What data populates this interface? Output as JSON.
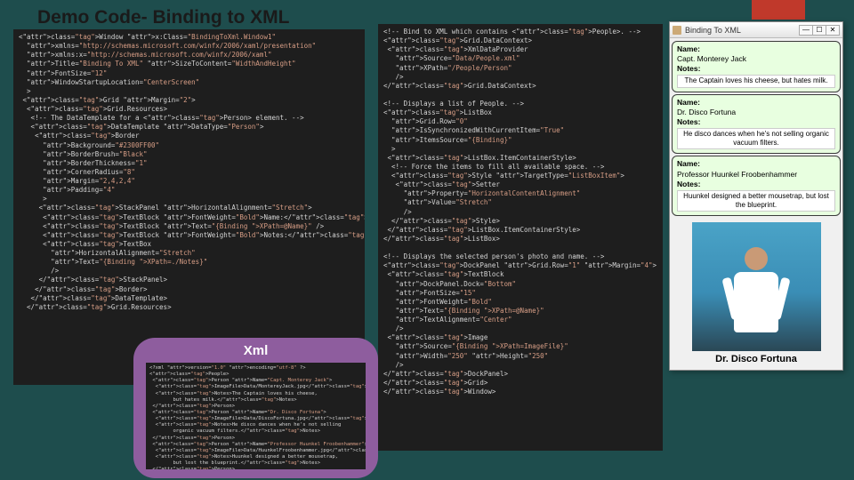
{
  "slide": {
    "title": "Demo Code- Binding to XML"
  },
  "code_left": "<Window x:Class=\"BindingToXml.Window1\"\n  xmlns=\"http://schemas.microsoft.com/winfx/2006/xaml/presentation\"\n  xmlns:x=\"http://schemas.microsoft.com/winfx/2006/xaml\"\n  Title=\"Binding To XML\" SizeToContent=\"WidthAndHeight\"\n  FontSize=\"12\"\n  WindowStartupLocation=\"CenterScreen\"\n  >\n <Grid Margin=\"2\">\n  <Grid.Resources>\n   <!-- The DataTemplate for a <Person> element. -->\n   <DataTemplate DataType=\"Person\">\n    <Border\n      Background=\"#2300FF00\"\n      BorderBrush=\"Black\"\n      BorderThickness=\"1\"\n      CornerRadius=\"8\"\n      Margin=\"2,4,2,4\"\n      Padding=\"4\"\n      >\n     <StackPanel HorizontalAlignment=\"Stretch\">\n      <TextBlock FontWeight=\"Bold\">Name:</TextBlock>\n      <TextBlock Text=\"{Binding XPath=@Name}\" />\n      <TextBlock FontWeight=\"Bold\">Notes:</TextBlock>\n      <TextBox\n        HorizontalAlignment=\"Stretch\"\n        Text=\"{Binding XPath=./Notes}\"\n        />\n     </StackPanel>\n    </Border>\n   </DataTemplate>\n  </Grid.Resources>",
  "code_mid": "<!-- Bind to XML which contains <People>. -->\n<Grid.DataContext>\n <XmlDataProvider\n   Source=\"Data/People.xml\"\n   XPath=\"/People/Person\"\n   />\n</Grid.DataContext>\n\n<!-- Displays a list of People. -->\n<ListBox\n  Grid.Row=\"0\"\n  IsSynchronizedWithCurrentItem=\"True\"\n  ItemsSource=\"{Binding}\"\n  >\n <ListBox.ItemContainerStyle>\n  <!-- Force the items to fill all available space. -->\n  <Style TargetType=\"ListBoxItem\">\n   <Setter\n     Property=\"HorizontalContentAlignment\"\n     Value=\"Stretch\"\n     />\n  </Style>\n </ListBox.ItemContainerStyle>\n</ListBox>\n\n<!-- Displays the selected person's photo and name. -->\n<DockPanel Grid.Row=\"1\" Margin=\"4\">\n <TextBlock\n   DockPanel.Dock=\"Bottom\"\n   FontSize=\"15\"\n   FontWeight=\"Bold\"\n   Text=\"{Binding XPath=@Name}\"\n   TextAlignment=\"Center\"\n   />\n <Image\n   Source=\"{Binding XPath=ImageFile}\"\n   Width=\"250\" Height=\"250\"\n   />\n</DockPanel>\n</Grid>\n</Window>",
  "callout": {
    "label": "Xml"
  },
  "xml_code": "<?xml version=\"1.0\" encoding=\"utf-8\" ?>\n<People>\n <Person Name=\"Capt. Monterey Jack\">\n  <ImageFile>Data/MontereyJack.jpg</ImageFile>\n  <Notes>The Captain loves his cheese,\n        but hates milk.</Notes>\n </Person>\n <Person Name=\"Dr. Disco Fortuna\">\n  <ImageFile>Data/DiscoFortuna.jpg</ImageFile>\n  <Notes>He disco dances when he's not selling\n        organic vacuum filters.</Notes>\n </Person>\n <Person Name=\"Professor Huunkel Froobenhammer\">\n  <ImageFile>Data/HuunkelFroobenhammer.jpg</ImageFile>\n  <Notes>Huunkel designed a better mousetrap,\n        but lost the blueprint.</Notes>\n </Person>\n</People>",
  "window": {
    "title": "Binding To XML",
    "btn_min": "—",
    "btn_max": "☐",
    "btn_close": "✕",
    "label_name": "Name:",
    "label_notes": "Notes:",
    "people": [
      {
        "name": "Capt. Monterey Jack",
        "notes": "The Captain loves his cheese,\nbut hates milk."
      },
      {
        "name": "Dr. Disco Fortuna",
        "notes": "He disco dances when he's not selling\norganic vacuum filters."
      },
      {
        "name": "Professor Huunkel Froobenhammer",
        "notes": "Huunkel designed a better mousetrap,\nbut lost the blueprint."
      }
    ],
    "selected_caption": "Dr. Disco Fortuna"
  }
}
